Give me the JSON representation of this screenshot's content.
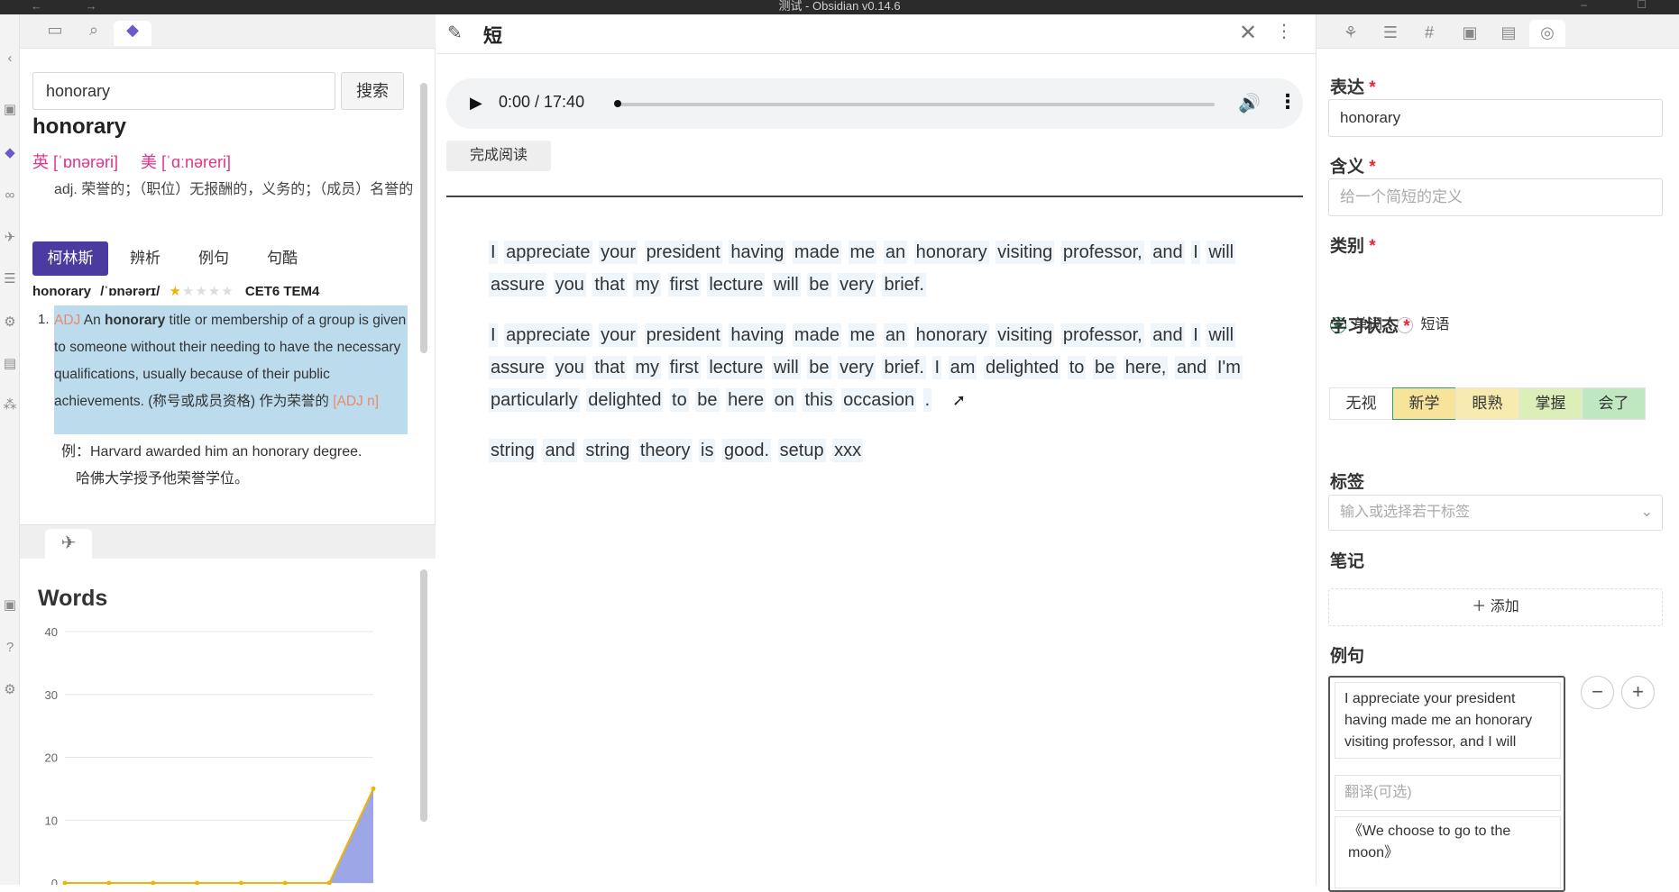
{
  "window": {
    "title": "测试 - Obsidian v0.14.6",
    "nav": "← →",
    "controls": "– ☐"
  },
  "ribbon": {
    "icons": [
      "‹",
      "▣",
      "◆",
      "∞",
      "✈",
      "☰",
      "⚙",
      "▤",
      "⁂",
      "▣",
      "?",
      "⚙"
    ]
  },
  "left_tabs": {
    "icons": [
      "▭",
      "⌕",
      "◆"
    ]
  },
  "dictionary": {
    "search_value": "honorary",
    "search_button": "搜索",
    "headword": "honorary",
    "phon_uk": "英 [ˈɒnərəri]",
    "phon_us": "美 [ˈɑːnəreri]",
    "definition": "adj. 荣誉的；（职位）无报酬的，义务的；（成员）名誉的",
    "tabs": [
      "柯林斯",
      "辨析",
      "例句",
      "句酷"
    ],
    "entry_word": "honorary",
    "entry_phon": "/ˈɒnərərɪ/",
    "entry_stars_on": "★",
    "entry_stars_off": "★★★★",
    "entry_levels": "CET6 TEM4",
    "sense_number": "1.",
    "sense_pos": "ADJ",
    "sense_pre": "An",
    "sense_bold": "honorary",
    "sense_text": "title or membership of a group is given to someone without their needing to have the necessary qualifications, usually because of their public achievements. (称号或成员资格) 作为荣誉的",
    "sense_tag": "[ADJ n]",
    "example_en": "例：Harvard awarded him an honorary degree.",
    "example_zh": "哈佛大学授予他荣誉学位。"
  },
  "chart_panel": {
    "tab_icon": "✈"
  },
  "chart_data": {
    "type": "area",
    "title": "Words",
    "ylim": [
      0,
      40
    ],
    "yticks": [
      0,
      10,
      20,
      30,
      40
    ],
    "x": [
      1,
      2,
      3,
      4,
      5,
      6,
      7,
      8
    ],
    "values": [
      0,
      0,
      0,
      0,
      0,
      0,
      0,
      15
    ],
    "colors": {
      "line": "#f0b400",
      "fill": "#9da6e6"
    }
  },
  "main": {
    "title": "短",
    "pen_icon": "✎",
    "close_icon": "✕",
    "more_icon": "⋮",
    "audio": {
      "play": "▶",
      "time": "0:00 / 17:40",
      "volume": "🔊",
      "more": "⋮",
      "progress": 0
    },
    "finish_button": "完成阅读",
    "paragraphs": [
      [
        "I",
        "appreciate",
        "your",
        "president",
        "having",
        "made",
        "me",
        "an",
        "honorary",
        "visiting",
        "professor,",
        "and",
        "I",
        "will",
        "assure",
        "you",
        "that",
        "my",
        "first",
        "lecture",
        "will",
        "be",
        "very",
        "brief."
      ],
      [
        "I",
        "appreciate",
        "your",
        "president",
        "having",
        "made",
        "me",
        "an",
        "honorary",
        "visiting",
        "professor,",
        "and",
        "I",
        "will",
        "assure",
        "you",
        "that",
        "my",
        "first",
        "lecture",
        "will",
        "be",
        "very",
        "brief.",
        "I",
        "am",
        "delighted",
        "to",
        "be",
        "here,",
        "and",
        "I'm",
        "particularly",
        "delighted",
        "to",
        "be",
        "here",
        "on",
        "this",
        "occasion",
        "."
      ],
      [
        "string",
        "and",
        "string",
        "theory",
        "is",
        "good.",
        "setup",
        "xxx"
      ]
    ]
  },
  "right_tabs": {
    "icons": [
      "⚘",
      "☰",
      "#",
      "▣",
      "▤",
      "◎"
    ]
  },
  "form": {
    "expression_label": "表达",
    "expression_value": "honorary",
    "meaning_label": "含义",
    "meaning_placeholder": "给一个简短的定义",
    "category_label": "类别",
    "category_options": [
      "单词",
      "短语"
    ],
    "status_label": "学习状态",
    "status_options": [
      "无视",
      "新学",
      "眼熟",
      "掌握",
      "会了"
    ],
    "status_colors": [
      "#ffffff",
      "#f7e39a",
      "#f7ebb0",
      "#dcefb9",
      "#bfe8c0"
    ],
    "tags_label": "标签",
    "tags_placeholder": "输入或选择若干标签",
    "notes_label": "笔记",
    "add_label": "＋ 添加",
    "examples_label": "例句",
    "example_text": "I appreciate your president having made me an honorary visiting professor, and I will",
    "translation_placeholder": "翻译(可选)",
    "example_source": "《We choose to go to the moon》",
    "minus": "−",
    "plus": "+",
    "required_mark": "*"
  }
}
